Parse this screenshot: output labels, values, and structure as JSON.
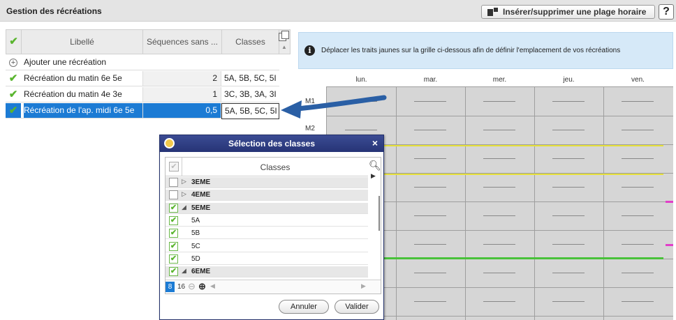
{
  "header": {
    "title": "Gestion des récréations",
    "insert_button": "Insérer/supprimer une plage horaire",
    "help_button": "?"
  },
  "left_table": {
    "columns": [
      "Libellé",
      "Séquences sans ...",
      "Classes"
    ],
    "add_row": "Ajouter une récréation",
    "rows": [
      {
        "label": "Récréation du matin 6e 5e",
        "sequences": "2",
        "classes": "5A, 5B, 5C, 5I"
      },
      {
        "label": "Récréation du matin 4e 3e",
        "sequences": "1",
        "classes": "3C, 3B, 3A, 3I"
      },
      {
        "label": "Récréation de l'ap. midi 6e 5e",
        "sequences": "0,5",
        "classes": "5A, 5B, 5C, 5I"
      }
    ]
  },
  "info": {
    "text": "Déplacer les traits jaunes sur la grille ci-dessous afin de définir l'emplacement de vos récréations"
  },
  "grid": {
    "days": [
      "lun.",
      "mar.",
      "mer.",
      "jeu.",
      "ven."
    ],
    "hour_labels": [
      "M1",
      "M2"
    ]
  },
  "modal": {
    "title": "Sélection des classes",
    "close": "×",
    "column_header": "Classes",
    "items": [
      {
        "label": "3EME",
        "group": true,
        "expanded": false,
        "checked": false
      },
      {
        "label": "4EME",
        "group": true,
        "expanded": false,
        "checked": false
      },
      {
        "label": "5EME",
        "group": true,
        "expanded": true,
        "checked": true
      },
      {
        "label": "5A",
        "group": false,
        "checked": true
      },
      {
        "label": "5B",
        "group": false,
        "checked": true
      },
      {
        "label": "5C",
        "group": false,
        "checked": true
      },
      {
        "label": "5D",
        "group": false,
        "checked": true
      },
      {
        "label": "6EME",
        "group": true,
        "expanded": true,
        "checked": true
      }
    ],
    "selected_count": "8",
    "total_count": "16",
    "cancel_button": "Annuler",
    "validate_button": "Valider"
  },
  "colors": {
    "selection_blue": "#1c7bd4",
    "check_green": "#5ab52f",
    "yellow_line": "#e6e03a",
    "green_line": "#49c23a",
    "magenta_marker": "#e23ec9",
    "modal_header": "#2b3a7d"
  }
}
